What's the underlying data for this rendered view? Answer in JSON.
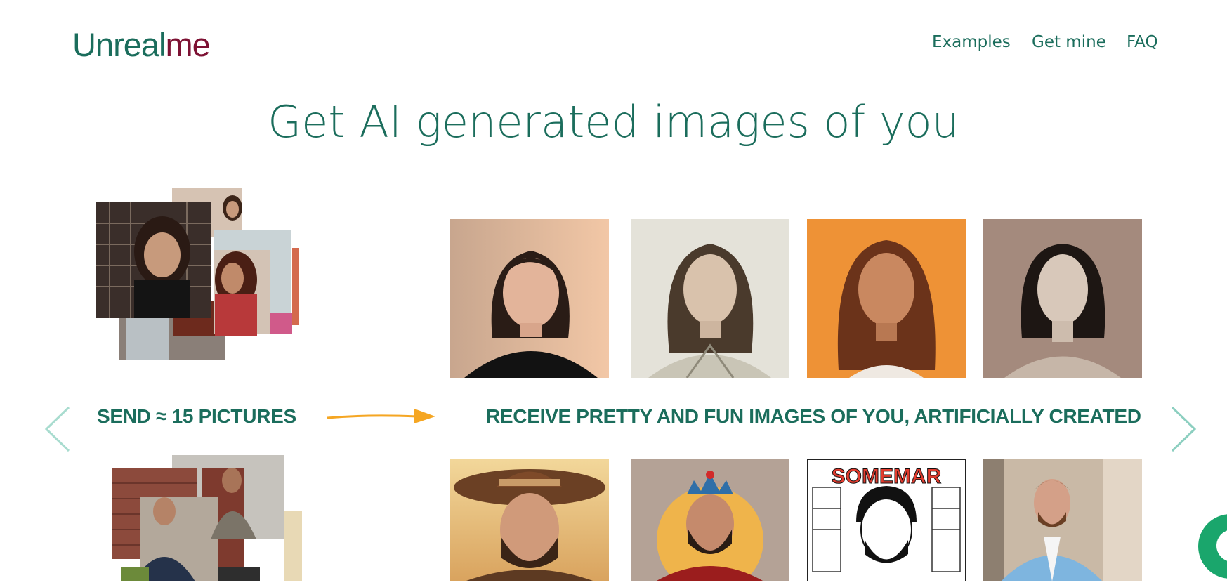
{
  "header": {
    "logo_part1": "Unreal",
    "logo_part2": "me",
    "nav": [
      "Examples",
      "Get mine",
      "FAQ"
    ]
  },
  "hero": {
    "title": "Get AI generated images of you"
  },
  "steps": {
    "send_caption": "SEND ≈ 15 PICTURES",
    "receive_caption": "RECEIVE PRETTY AND FUN IMAGES OF YOU, ARTIFICIALLY CREATED"
  },
  "carousel": {
    "prev_icon": "chevron-left-icon",
    "next_icon": "chevron-right-icon"
  },
  "examples": {
    "row1_descriptions": [
      "woman-portrait-black-top",
      "woman-portrait-armor-sketch",
      "woman-portrait-orange-background",
      "woman-portrait-sketch-style"
    ],
    "row2_descriptions": [
      "man-cowboy-hat",
      "man-king-crown",
      "man-coloring-book",
      "man-blue-suit"
    ],
    "comic_text": "SOMEMAR"
  },
  "chat_widget": {
    "icon": "chat-bubble-icon"
  },
  "colors": {
    "brand_green": "#1b6d5c",
    "brand_maroon": "#7d1133",
    "arrow": "#f5a623",
    "chevron": "#8ccfc0",
    "chat": "#1aa66c"
  }
}
